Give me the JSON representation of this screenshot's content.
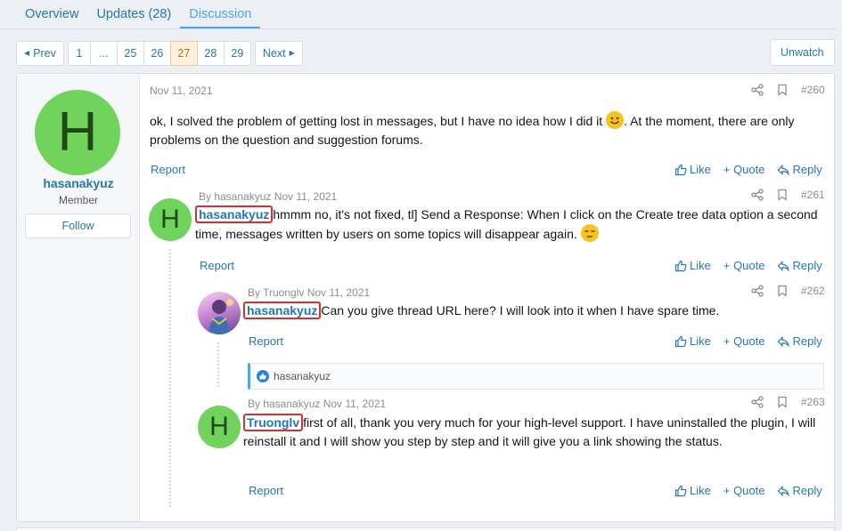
{
  "tabs": [
    {
      "label": "Overview"
    },
    {
      "label": "Updates (28)"
    },
    {
      "label": "Discussion"
    }
  ],
  "pagination": {
    "prev": "Prev",
    "next": "Next",
    "pages": [
      "1",
      "...",
      "25",
      "26",
      "27",
      "28",
      "29"
    ],
    "current": "27"
  },
  "unwatch": "Unwatch",
  "author": {
    "initial": "H",
    "name": "hasanakyuz",
    "role": "Member",
    "follow": "Follow"
  },
  "posts": [
    {
      "meta": "Nov 11, 2021",
      "number": "#260",
      "text_a": "ok, I solved the problem of getting lost in messages, but I have no idea how I did it",
      "text_b": ". At the moment, there are only problems on the question and suggestion forums."
    },
    {
      "meta": "By hasanakyuz Nov 11, 2021",
      "number": "#261",
      "avatar_initial": "H",
      "mention": "hasanakyuz",
      "text": "hmmm no, it's not fixed, tl] Send a Response: When I click on the Create tree data option a second time, messages written by users on some topics will disappear again."
    },
    {
      "meta": "By Truonglv Nov 11, 2021",
      "number": "#262",
      "mention": "hasanakyuz",
      "text": "Can you give thread URL here? I will look into it when I have spare time.",
      "liked_by": "hasanakyuz"
    },
    {
      "meta": "By hasanakyuz Nov 11, 2021",
      "number": "#263",
      "avatar_initial": "H",
      "mention": "Truonglv",
      "text": "first of all, thank you very much for your high-level support. I have uninstalled the plugin, I will reinstall it and I will show you step by step and it will give you a link showing the status."
    }
  ],
  "actions": {
    "report": "Report",
    "like": "Like",
    "quote": "+ Quote",
    "reply": "Reply"
  },
  "colors": {
    "link": "#2577b1",
    "active_tab": "#47a7eb",
    "avatar_bg": "#6fd35c",
    "mention_highlight": "#d9302f",
    "current_page_bg": "#fdf1dd"
  }
}
